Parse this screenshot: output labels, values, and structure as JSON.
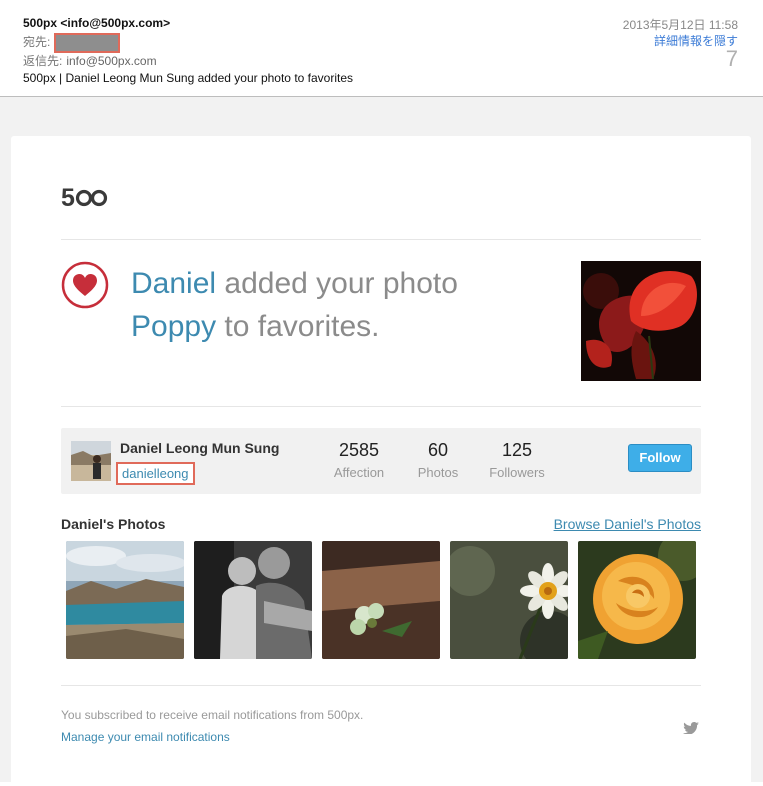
{
  "header": {
    "from": "500px <info@500px.com>",
    "to_label": "宛先:",
    "reply_label": "返信先:",
    "reply_value": "info@500px.com",
    "subject": "500px | Daniel Leong Mun Sung added your photo to favorites",
    "date": "2013年5月12日 11:58",
    "hide_details": "詳細情報を隠す",
    "count": "7"
  },
  "notification": {
    "actor": "Daniel",
    "text_1": "added your photo",
    "photo_title": "Poppy",
    "text_2": "to favorites."
  },
  "profile": {
    "name": "Daniel Leong Mun Sung",
    "username": "danielleong",
    "stats": [
      {
        "value": "2585",
        "label": "Affection"
      },
      {
        "value": "60",
        "label": "Photos"
      },
      {
        "value": "125",
        "label": "Followers"
      }
    ],
    "follow_label": "Follow"
  },
  "photos": {
    "title": "Daniel's Photos",
    "browse_link": "Browse Daniel's Photos"
  },
  "footer": {
    "subscribed_text": "You subscribed to receive email notifications from 500px.",
    "manage_link": "Manage your email notifications"
  },
  "colors": {
    "accent_blue": "#3d8ab0",
    "heart_red": "#c62e3a",
    "follow_button": "#3eaee8",
    "redact_outline": "#e06a5a"
  }
}
